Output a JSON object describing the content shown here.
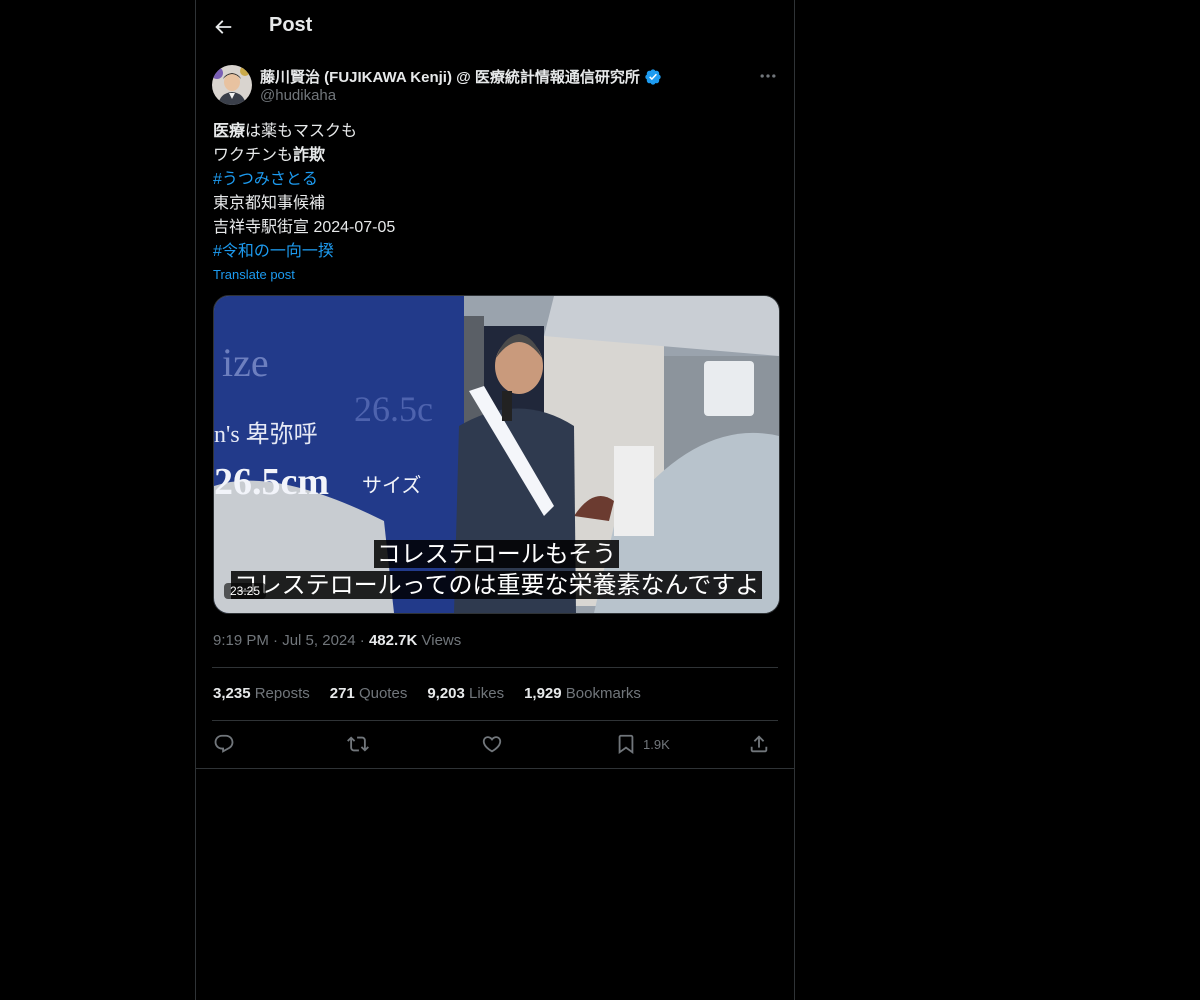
{
  "header": {
    "title": "Post"
  },
  "author": {
    "name": "藤川賢治 (FUJIKAWA Kenji) @ 医療統計情報通信研究所",
    "handle": "@hudikaha",
    "verified": true
  },
  "tweet": {
    "line1_bold": "医療",
    "line1_rest": "は薬もマスクも",
    "line2_rest": "ワクチンも",
    "line2_bold": "詐欺",
    "hashtag1": "#うつみさとる",
    "line4": "東京都知事候補",
    "line5": "吉祥寺駅街宣 2024-07-05",
    "hashtag2": "#令和の一向一揆",
    "translate_label": "Translate post"
  },
  "media": {
    "subtitle_line1": "コレステロールもそう",
    "subtitle_line2": "コレステロールってのは重要な栄養素なんですよ",
    "duration": "23:25",
    "sign_text_1": "ize",
    "sign_text_2": "n's 卑弥呼",
    "sign_text_3": "26.5cm",
    "sign_text_4": "サイズ",
    "sign_text_5": "26.5c"
  },
  "meta": {
    "time": "9:19 PM",
    "date": "Jul 5, 2024",
    "views_count": "482.7K",
    "views_label": "Views"
  },
  "stats": {
    "reposts_count": "3,235",
    "reposts_label": "Reposts",
    "quotes_count": "271",
    "quotes_label": "Quotes",
    "likes_count": "9,203",
    "likes_label": "Likes",
    "bookmarks_count": "1,929",
    "bookmarks_label": "Bookmarks"
  },
  "actions": {
    "bookmark_count": "1.9K"
  },
  "colors": {
    "background": "#000000",
    "accent": "#1d9bf0",
    "border": "#2f3336",
    "muted": "#71767b"
  }
}
